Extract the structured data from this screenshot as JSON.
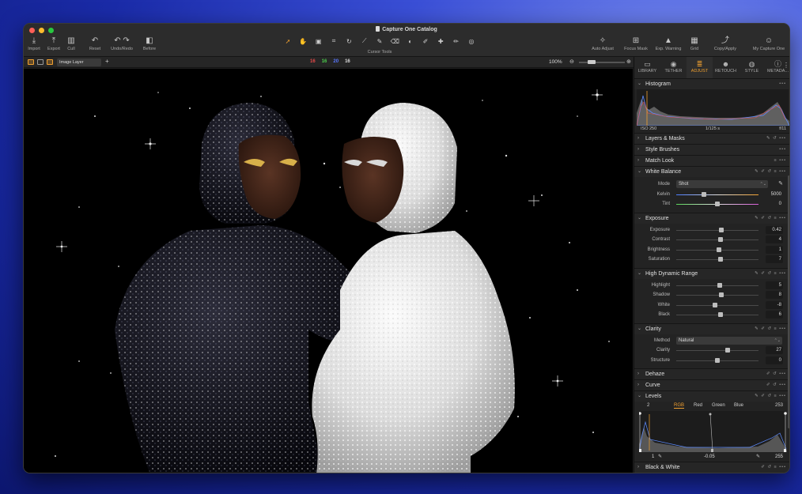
{
  "window": {
    "title": "Capture One Catalog"
  },
  "toolbar": {
    "left": [
      {
        "icon": "import-icon",
        "label": "Import"
      },
      {
        "icon": "export-icon",
        "label": "Export"
      },
      {
        "icon": "cull-icon",
        "label": "Cull"
      },
      {
        "icon": "reset-icon",
        "label": "Reset"
      },
      {
        "icon": "undo-redo-icon",
        "label": "Undo/Redo"
      },
      {
        "icon": "before-icon",
        "label": "Before"
      }
    ],
    "cursor_tools_label": "Cursor Tools",
    "right": [
      {
        "icon": "auto-adjust-icon",
        "label": "Auto Adjust"
      },
      {
        "icon": "focus-mask-icon",
        "label": "Focus Mask"
      },
      {
        "icon": "exp-warning-icon",
        "label": "Exp. Warning"
      },
      {
        "icon": "grid-icon",
        "label": "Grid"
      },
      {
        "icon": "copy-apply-icon",
        "label": "Copy/Apply"
      },
      {
        "icon": "my-capture-one-icon",
        "label": "My Capture One"
      }
    ]
  },
  "viewer_bar": {
    "layer_select": "Image Layer",
    "counts": [
      {
        "value": "16",
        "color": "#e84a4a"
      },
      {
        "value": "16",
        "color": "#4ccf4c"
      },
      {
        "value": "20",
        "color": "#5a78ff"
      },
      {
        "value": "16",
        "color": "#dddddd"
      }
    ],
    "zoom": "100%"
  },
  "tabs": [
    {
      "label": "LIBRARY",
      "icon": "library-icon",
      "active": false
    },
    {
      "label": "TETHER",
      "icon": "tether-icon",
      "active": false
    },
    {
      "label": "ADJUST",
      "icon": "adjust-icon",
      "active": true
    },
    {
      "label": "RETOUCH",
      "icon": "retouch-icon",
      "active": false
    },
    {
      "label": "STYLE",
      "icon": "style-icon",
      "active": false
    },
    {
      "label": "METADA...",
      "icon": "metadata-icon",
      "active": false
    }
  ],
  "histogram": {
    "title": "Histogram",
    "iso": "ISO 250",
    "shutter": "1/125 s",
    "aperture": "f/11"
  },
  "collapsed": {
    "layers": "Layers & Masks",
    "style_brushes": "Style Brushes",
    "match_look": "Match Look",
    "dehaze": "Dehaze",
    "curve": "Curve",
    "black_white": "Black & White"
  },
  "white_balance": {
    "title": "White Balance",
    "mode_label": "Mode",
    "mode_value": "Shot",
    "kelvin_label": "Kelvin",
    "kelvin_value": "5000",
    "tint_label": "Tint",
    "tint_value": "0"
  },
  "exposure": {
    "title": "Exposure",
    "rows": [
      {
        "label": "Exposure",
        "value": "0.42"
      },
      {
        "label": "Contrast",
        "value": "4"
      },
      {
        "label": "Brightness",
        "value": "1"
      },
      {
        "label": "Saturation",
        "value": "7"
      }
    ]
  },
  "hdr": {
    "title": "High Dynamic Range",
    "rows": [
      {
        "label": "Highlight",
        "value": "5"
      },
      {
        "label": "Shadow",
        "value": "8"
      },
      {
        "label": "White",
        "value": "-8"
      },
      {
        "label": "Black",
        "value": "6"
      }
    ]
  },
  "clarity": {
    "title": "Clarity",
    "method_label": "Method",
    "method_value": "Natural",
    "clarity_label": "Clarity",
    "clarity_value": "27",
    "structure_label": "Structure",
    "structure_value": "0"
  },
  "levels": {
    "title": "Levels",
    "left_value": "2",
    "right_value": "253",
    "channels": [
      "RGB",
      "Red",
      "Green",
      "Blue"
    ],
    "bottom_left": "1",
    "bottom_mid": "-0.05",
    "bottom_right": "255"
  }
}
